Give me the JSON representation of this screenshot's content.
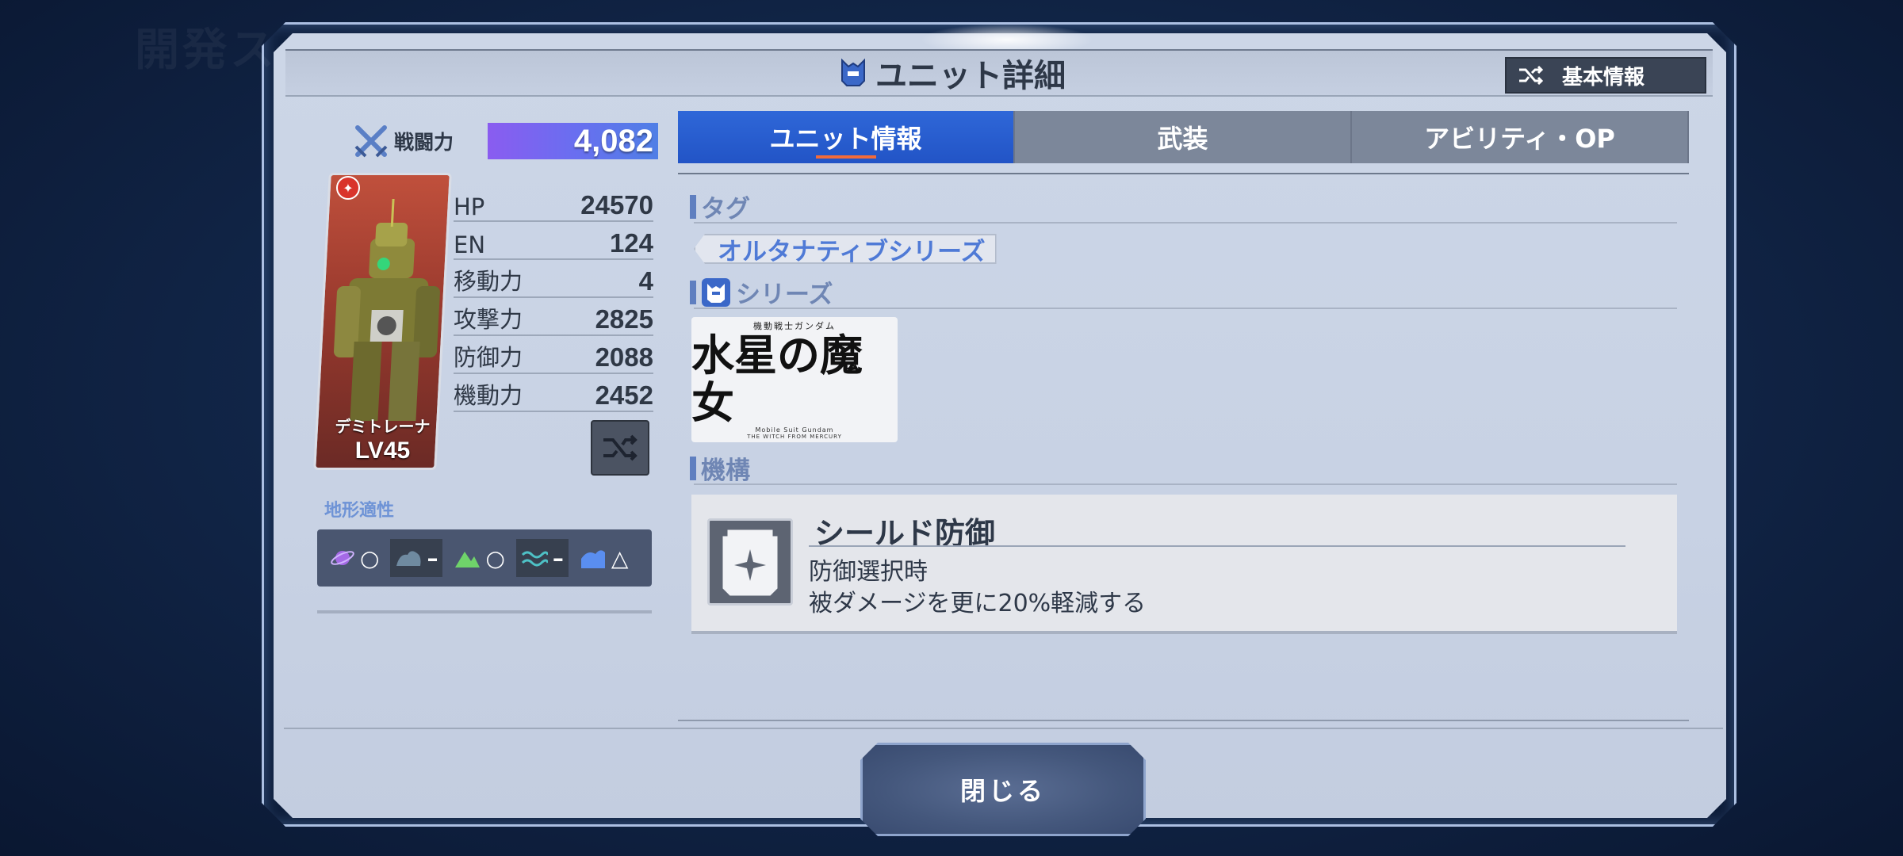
{
  "background_text": "開発ス",
  "header": {
    "title": "ユニット詳細",
    "basic_info_button": "基本情報"
  },
  "combat_power": {
    "label": "戦闘力",
    "value": "4,082"
  },
  "unit": {
    "name": "デミトレーナ",
    "level": "LV45"
  },
  "stats": [
    {
      "label": "HP",
      "value": "24570"
    },
    {
      "label": "EN",
      "value": "124"
    },
    {
      "label": "移動力",
      "value": "4"
    },
    {
      "label": "攻撃力",
      "value": "2825"
    },
    {
      "label": "防御力",
      "value": "2088"
    },
    {
      "label": "機動力",
      "value": "2452"
    }
  ],
  "terrain": {
    "label": "地形適性",
    "items": [
      {
        "icon": "space-icon",
        "rating": "○"
      },
      {
        "icon": "air-icon",
        "rating": "–"
      },
      {
        "icon": "ground-icon",
        "rating": "○"
      },
      {
        "icon": "water-icon",
        "rating": "–"
      },
      {
        "icon": "underwater-icon",
        "rating": "△"
      }
    ]
  },
  "tabs": [
    {
      "label": "ユニット情報",
      "active": true
    },
    {
      "label": "武装",
      "active": false
    },
    {
      "label": "アビリティ・OP",
      "active": false
    }
  ],
  "sections": {
    "tag": {
      "heading": "タグ",
      "chip": "オルタナティブシリーズ"
    },
    "series": {
      "heading": "シリーズ",
      "logo": {
        "small": "機動戦士ガンダム",
        "main": "水星の魔女",
        "sub": "Mobile Suit Gundam",
        "sub2": "THE WITCH FROM MERCURY"
      }
    },
    "mechanism": {
      "heading": "機構",
      "title": "シールド防御",
      "desc1": "防御選択時",
      "desc2": "被ダメージを更に20%軽減する"
    }
  },
  "close_button": "閉じる",
  "colors": {
    "accent_blue": "#2254c6",
    "tab_underline": "#f26b3a",
    "cp_gradient_start": "#8a5cf0",
    "cp_gradient_end": "#4f7fe6"
  }
}
